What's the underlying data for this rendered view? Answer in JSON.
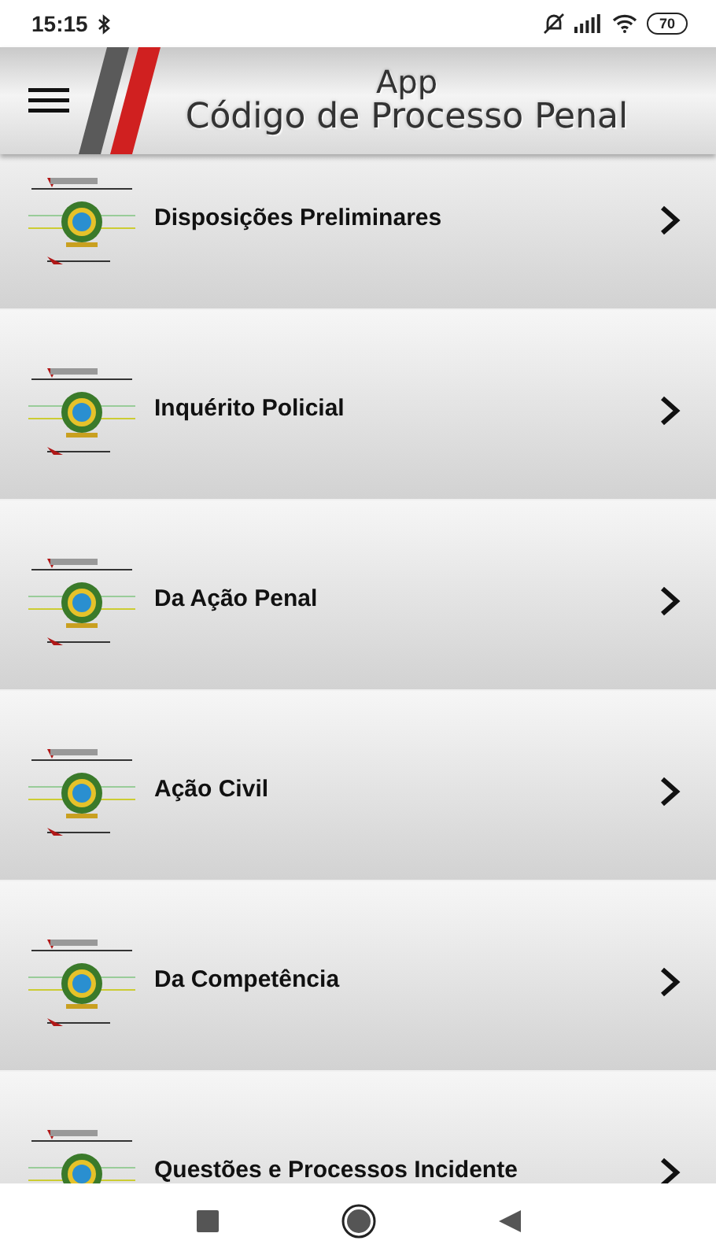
{
  "status_bar": {
    "time": "15:15",
    "battery": "70"
  },
  "header": {
    "title_line_1": "App",
    "title_line_2": "Código de Processo Penal"
  },
  "items": [
    {
      "title": "Disposições Preliminares"
    },
    {
      "title": "Inquérito Policial"
    },
    {
      "title": "Da Ação Penal"
    },
    {
      "title": "Ação Civil"
    },
    {
      "title": "Da Competência"
    },
    {
      "title": "Questões e Processos Incidente"
    }
  ]
}
